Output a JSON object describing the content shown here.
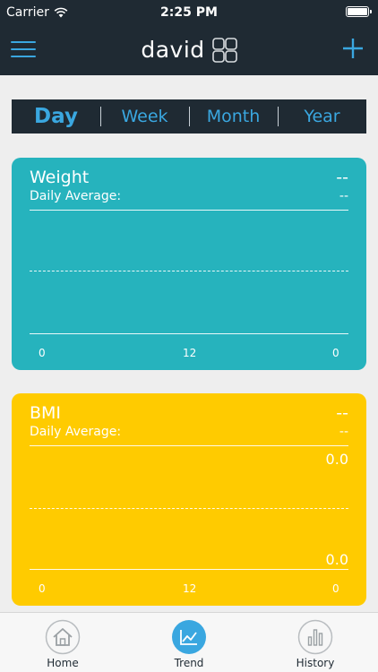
{
  "status_bar": {
    "carrier": "Carrier",
    "time": "2:25 PM"
  },
  "nav": {
    "title": "david"
  },
  "period_tabs": [
    {
      "label": "Day",
      "active": true
    },
    {
      "label": "Week",
      "active": false
    },
    {
      "label": "Month",
      "active": false
    },
    {
      "label": "Year",
      "active": false
    }
  ],
  "weight_card": {
    "title": "Weight",
    "value": "--",
    "subtitle": "Daily Average:",
    "subtitle_value": "--",
    "x_ticks": [
      "0",
      "12",
      "0"
    ]
  },
  "bmi_card": {
    "title": "BMI",
    "value": "--",
    "subtitle": "Daily Average:",
    "subtitle_value": "--",
    "y_top": "0.0",
    "y_bottom": "0.0",
    "x_ticks": [
      "0",
      "12",
      "0"
    ]
  },
  "tab_bar": {
    "home": "Home",
    "trend": "Trend",
    "history": "History",
    "active": "trend"
  },
  "colors": {
    "header": "#1f2a33",
    "accent": "#3aa7e0",
    "weight_card": "#26b3bd",
    "bmi_card": "#ffcb00",
    "background": "#eeeeee"
  }
}
